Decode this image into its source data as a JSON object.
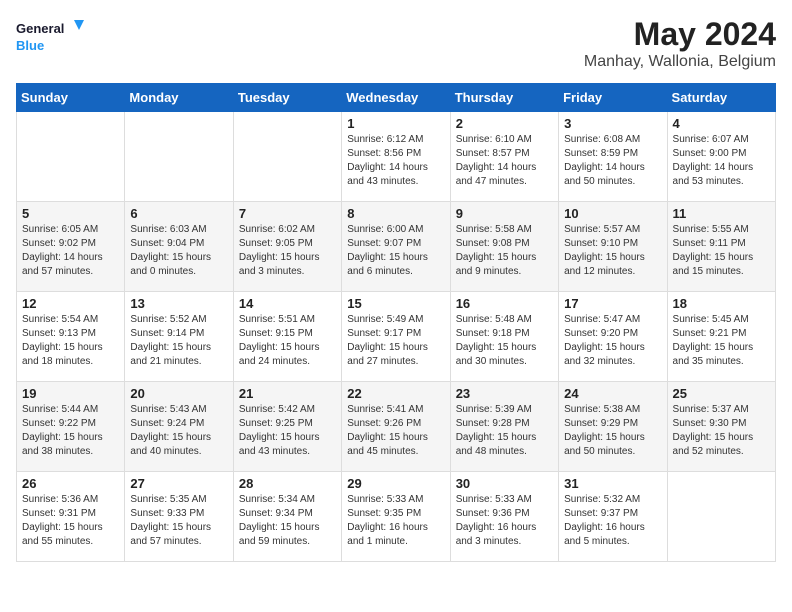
{
  "header": {
    "logo_line1": "General",
    "logo_line2": "Blue",
    "main_title": "May 2024",
    "subtitle": "Manhay, Wallonia, Belgium"
  },
  "days_of_week": [
    "Sunday",
    "Monday",
    "Tuesday",
    "Wednesday",
    "Thursday",
    "Friday",
    "Saturday"
  ],
  "weeks": [
    [
      {
        "day": "",
        "info": ""
      },
      {
        "day": "",
        "info": ""
      },
      {
        "day": "",
        "info": ""
      },
      {
        "day": "1",
        "info": "Sunrise: 6:12 AM\nSunset: 8:56 PM\nDaylight: 14 hours\nand 43 minutes."
      },
      {
        "day": "2",
        "info": "Sunrise: 6:10 AM\nSunset: 8:57 PM\nDaylight: 14 hours\nand 47 minutes."
      },
      {
        "day": "3",
        "info": "Sunrise: 6:08 AM\nSunset: 8:59 PM\nDaylight: 14 hours\nand 50 minutes."
      },
      {
        "day": "4",
        "info": "Sunrise: 6:07 AM\nSunset: 9:00 PM\nDaylight: 14 hours\nand 53 minutes."
      }
    ],
    [
      {
        "day": "5",
        "info": "Sunrise: 6:05 AM\nSunset: 9:02 PM\nDaylight: 14 hours\nand 57 minutes."
      },
      {
        "day": "6",
        "info": "Sunrise: 6:03 AM\nSunset: 9:04 PM\nDaylight: 15 hours\nand 0 minutes."
      },
      {
        "day": "7",
        "info": "Sunrise: 6:02 AM\nSunset: 9:05 PM\nDaylight: 15 hours\nand 3 minutes."
      },
      {
        "day": "8",
        "info": "Sunrise: 6:00 AM\nSunset: 9:07 PM\nDaylight: 15 hours\nand 6 minutes."
      },
      {
        "day": "9",
        "info": "Sunrise: 5:58 AM\nSunset: 9:08 PM\nDaylight: 15 hours\nand 9 minutes."
      },
      {
        "day": "10",
        "info": "Sunrise: 5:57 AM\nSunset: 9:10 PM\nDaylight: 15 hours\nand 12 minutes."
      },
      {
        "day": "11",
        "info": "Sunrise: 5:55 AM\nSunset: 9:11 PM\nDaylight: 15 hours\nand 15 minutes."
      }
    ],
    [
      {
        "day": "12",
        "info": "Sunrise: 5:54 AM\nSunset: 9:13 PM\nDaylight: 15 hours\nand 18 minutes."
      },
      {
        "day": "13",
        "info": "Sunrise: 5:52 AM\nSunset: 9:14 PM\nDaylight: 15 hours\nand 21 minutes."
      },
      {
        "day": "14",
        "info": "Sunrise: 5:51 AM\nSunset: 9:15 PM\nDaylight: 15 hours\nand 24 minutes."
      },
      {
        "day": "15",
        "info": "Sunrise: 5:49 AM\nSunset: 9:17 PM\nDaylight: 15 hours\nand 27 minutes."
      },
      {
        "day": "16",
        "info": "Sunrise: 5:48 AM\nSunset: 9:18 PM\nDaylight: 15 hours\nand 30 minutes."
      },
      {
        "day": "17",
        "info": "Sunrise: 5:47 AM\nSunset: 9:20 PM\nDaylight: 15 hours\nand 32 minutes."
      },
      {
        "day": "18",
        "info": "Sunrise: 5:45 AM\nSunset: 9:21 PM\nDaylight: 15 hours\nand 35 minutes."
      }
    ],
    [
      {
        "day": "19",
        "info": "Sunrise: 5:44 AM\nSunset: 9:22 PM\nDaylight: 15 hours\nand 38 minutes."
      },
      {
        "day": "20",
        "info": "Sunrise: 5:43 AM\nSunset: 9:24 PM\nDaylight: 15 hours\nand 40 minutes."
      },
      {
        "day": "21",
        "info": "Sunrise: 5:42 AM\nSunset: 9:25 PM\nDaylight: 15 hours\nand 43 minutes."
      },
      {
        "day": "22",
        "info": "Sunrise: 5:41 AM\nSunset: 9:26 PM\nDaylight: 15 hours\nand 45 minutes."
      },
      {
        "day": "23",
        "info": "Sunrise: 5:39 AM\nSunset: 9:28 PM\nDaylight: 15 hours\nand 48 minutes."
      },
      {
        "day": "24",
        "info": "Sunrise: 5:38 AM\nSunset: 9:29 PM\nDaylight: 15 hours\nand 50 minutes."
      },
      {
        "day": "25",
        "info": "Sunrise: 5:37 AM\nSunset: 9:30 PM\nDaylight: 15 hours\nand 52 minutes."
      }
    ],
    [
      {
        "day": "26",
        "info": "Sunrise: 5:36 AM\nSunset: 9:31 PM\nDaylight: 15 hours\nand 55 minutes."
      },
      {
        "day": "27",
        "info": "Sunrise: 5:35 AM\nSunset: 9:33 PM\nDaylight: 15 hours\nand 57 minutes."
      },
      {
        "day": "28",
        "info": "Sunrise: 5:34 AM\nSunset: 9:34 PM\nDaylight: 15 hours\nand 59 minutes."
      },
      {
        "day": "29",
        "info": "Sunrise: 5:33 AM\nSunset: 9:35 PM\nDaylight: 16 hours\nand 1 minute."
      },
      {
        "day": "30",
        "info": "Sunrise: 5:33 AM\nSunset: 9:36 PM\nDaylight: 16 hours\nand 3 minutes."
      },
      {
        "day": "31",
        "info": "Sunrise: 5:32 AM\nSunset: 9:37 PM\nDaylight: 16 hours\nand 5 minutes."
      },
      {
        "day": "",
        "info": ""
      }
    ]
  ]
}
